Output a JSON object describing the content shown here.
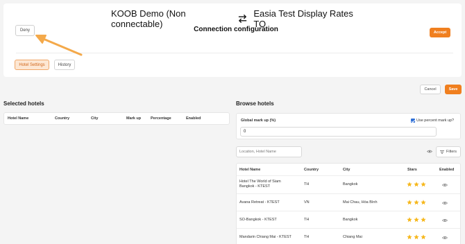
{
  "header": {
    "deny_label": "Deny",
    "source_name": "KOOB Demo (Non connectable)",
    "target_name": "Easia Test Display Rates TO",
    "subtitle": "Connection configuration",
    "accept_label": "Accept"
  },
  "tabs": [
    {
      "label": "Hotel Settings",
      "active": true
    },
    {
      "label": "History",
      "active": false
    }
  ],
  "actions": {
    "cancel_label": "Cancel",
    "save_label": "Save"
  },
  "selected_hotels": {
    "title": "Selected hotels",
    "columns": [
      "Hotel Name",
      "Country",
      "City",
      "Mark up",
      "Percentage",
      "Enabled"
    ]
  },
  "browse_hotels": {
    "title": "Browse hotels",
    "global_markup_label": "Global mark up (%)",
    "use_percent_label": "Use percent mark up?",
    "use_percent_checked": true,
    "global_markup_value": "0",
    "search_placeholder": "Location, Hotel Name",
    "filters_label": "Filters",
    "columns": [
      "Hotel Name",
      "Country",
      "City",
      "Stars",
      "Enabled"
    ],
    "rows": [
      {
        "name_line1": "Hotel The World of Siam",
        "name_line2": "Bangkok - KTEST",
        "country": "TH",
        "city": "Bangkok",
        "stars": 3
      },
      {
        "name_line1": "Avana Retreat - KTEST",
        "name_line2": "",
        "country": "VN",
        "city": "Mai Chau, Hòa Bình",
        "stars": 3
      },
      {
        "name_line1": "SO-Bangkok - KTEST",
        "name_line2": "",
        "country": "TH",
        "city": "Bangkok",
        "stars": 3
      },
      {
        "name_line1": "Mandarin Chiang Mai - KTEST",
        "name_line2": "",
        "country": "TH",
        "city": "Chiang Mai",
        "stars": 3
      }
    ]
  },
  "colors": {
    "accent": "#f07f1f",
    "star": "#f6b81e",
    "arrow": "#f4a94a"
  }
}
